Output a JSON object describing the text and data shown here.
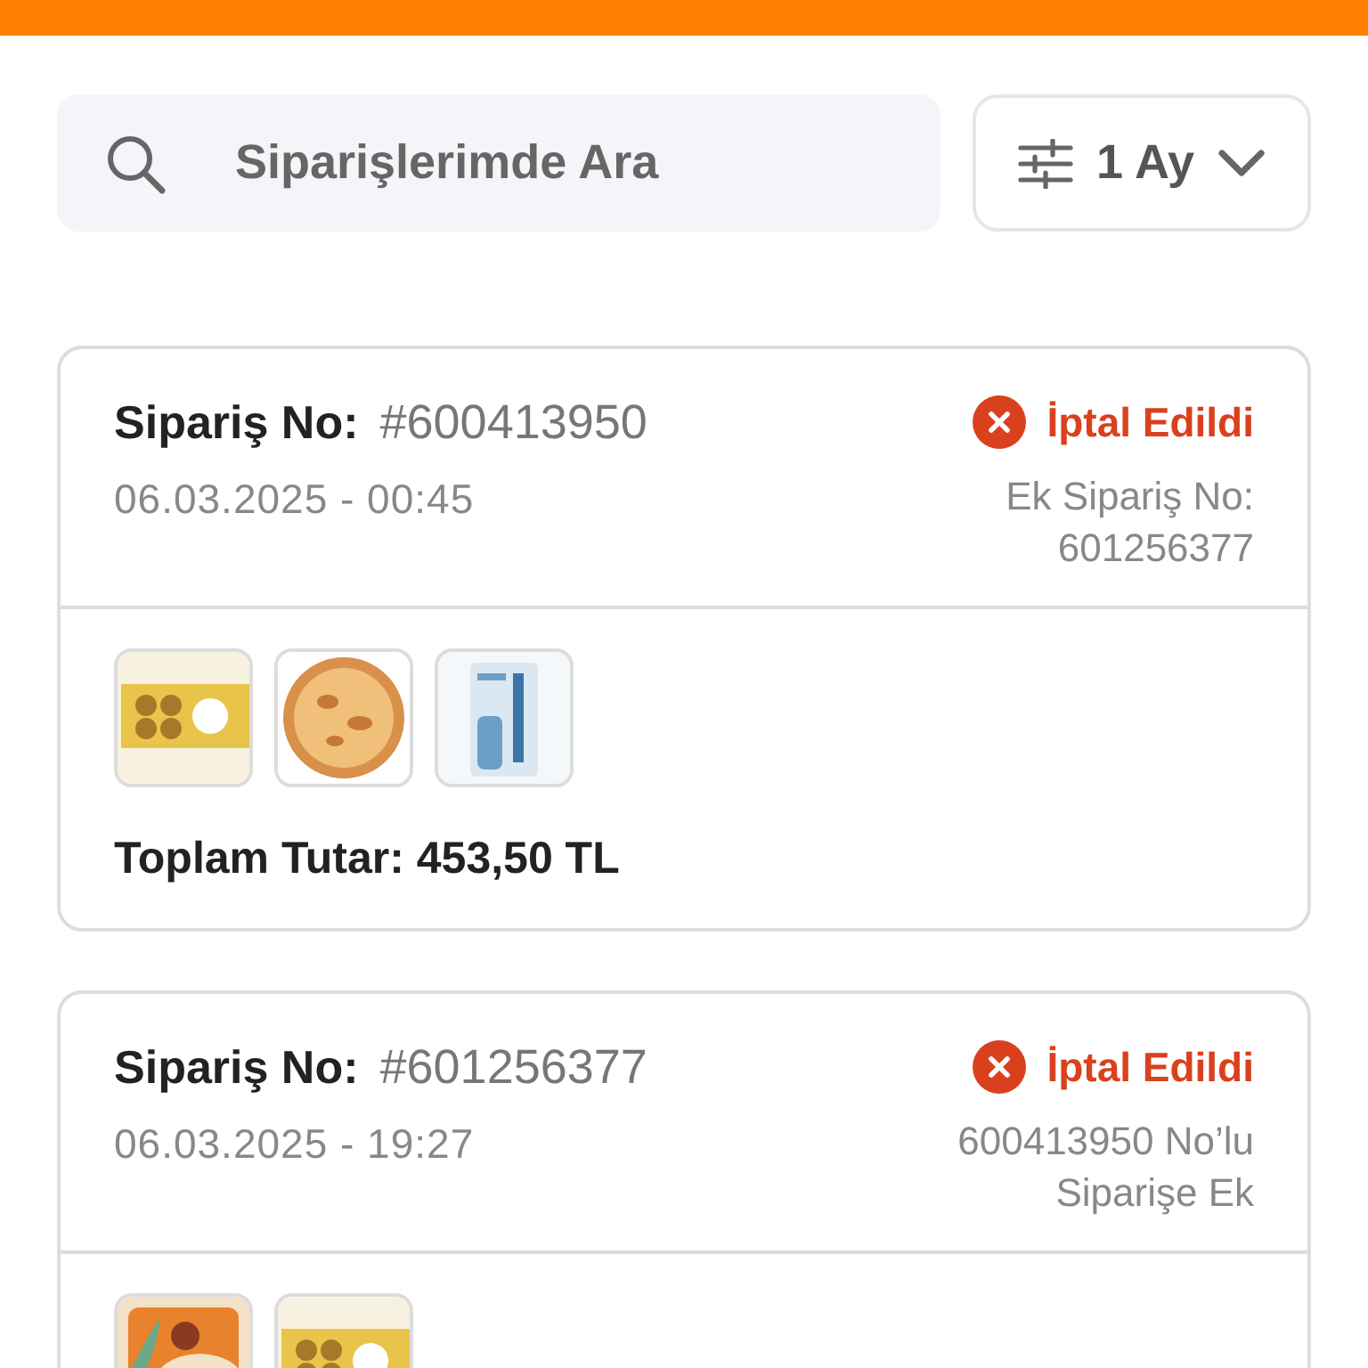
{
  "search": {
    "placeholder": "Siparişlerimde Ara"
  },
  "filter": {
    "label": "1 Ay"
  },
  "orders": [
    {
      "label": "Sipariş No:",
      "number": "#600413950",
      "date": "06.03.2025 - 00:45",
      "status": {
        "kind": "cancelled",
        "label": "İptal Edildi"
      },
      "note_lines": [
        "Ek Sipariş No:",
        "601256377"
      ],
      "items": [
        {
          "kind": "picture"
        },
        {
          "kind": "picture"
        },
        {
          "kind": "picture"
        }
      ],
      "total": "Toplam Tutar: 453,50 TL"
    },
    {
      "label": "Sipariş No:",
      "number": "#601256377",
      "date": "06.03.2025 - 19:27",
      "status": {
        "kind": "cancelled",
        "label": "İptal Edildi"
      },
      "note_lines": [
        "600413950 No’lu",
        "Siparişe Ek"
      ],
      "items": [
        {
          "kind": "picture"
        },
        {
          "kind": "picture"
        }
      ]
    }
  ]
}
